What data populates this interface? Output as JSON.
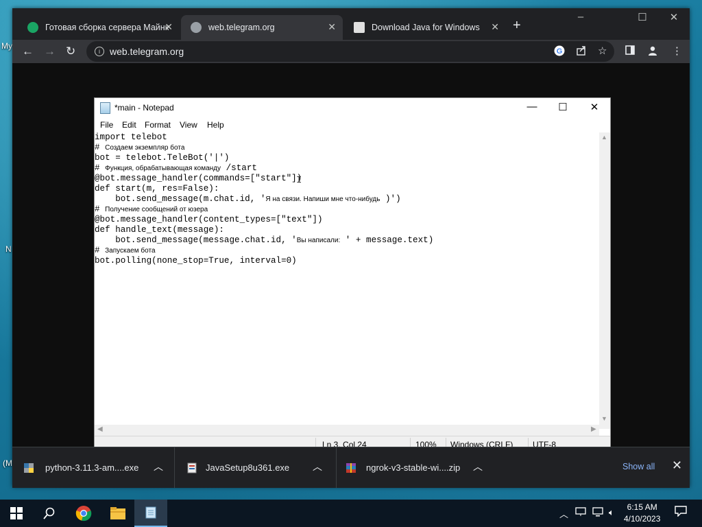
{
  "desktop": {
    "labels": [
      "My",
      "N",
      "(M"
    ]
  },
  "browser": {
    "tabs": [
      {
        "label": "Готовая сборка сервера Майнкрафт",
        "favicon_color": "#1aa564",
        "active": false
      },
      {
        "label": "web.telegram.org",
        "favicon_color": "#9aa0a6",
        "active": true
      },
      {
        "label": "Download Java for Windows",
        "favicon_color": "#e0e0e0",
        "active": false
      }
    ],
    "new_tab_symbol": "+",
    "window_controls": {
      "minimize": "‒",
      "maximize": "☐",
      "close": "✕"
    },
    "toolbar": {
      "back": "←",
      "forward": "→",
      "reload": "↻",
      "url": "web.telegram.org",
      "icons": [
        "google-icon",
        "share-icon",
        "bookmark-star-icon",
        "sidepanel-icon",
        "profile-icon",
        "menu-icon"
      ]
    }
  },
  "notepad": {
    "title": "*main - Notepad",
    "controls": {
      "minimize": "—",
      "maximize": "☐",
      "close": "✕"
    },
    "menu": [
      "File",
      "Edit",
      "Format",
      "View",
      "Help"
    ],
    "code": [
      {
        "code": "import telebot",
        "comment": ""
      },
      {
        "code": "# ",
        "comment": "Создаем экземпляр бота"
      },
      {
        "code": "bot = telebot.TeleBot('|')",
        "comment": ""
      },
      {
        "code": "# ",
        "comment": "Функция, обрабатывающая команду",
        "tail": " /start"
      },
      {
        "code": "@bot.message_handler(commands=[\"start\"])",
        "comment": ""
      },
      {
        "code": "def start(m, res=False):",
        "comment": ""
      },
      {
        "code": "    bot.send_message(m.chat.id, '",
        "comment": "Я на связи. Напиши мне что-нибудь",
        "tail": " )')"
      },
      {
        "code": "# ",
        "comment": "Получение сообщений от юзера"
      },
      {
        "code": "@bot.message_handler(content_types=[\"text\"])",
        "comment": ""
      },
      {
        "code": "def handle_text(message):",
        "comment": ""
      },
      {
        "code": "    bot.send_message(message.chat.id, '",
        "comment": "Вы написали:",
        "tail": " ' + message.text)"
      },
      {
        "code": "# ",
        "comment": "Запускаем бота"
      },
      {
        "code": "bot.polling(none_stop=True, interval=0)",
        "comment": ""
      }
    ],
    "status": {
      "position": "Ln 3, Col 24",
      "zoom": "100%",
      "line_ending": "Windows (CRLF)",
      "encoding": "UTF-8"
    }
  },
  "downloads": {
    "items": [
      {
        "name": "python-3.11.3-am....exe",
        "icon": "python-installer-icon"
      },
      {
        "name": "JavaSetup8u361.exe",
        "icon": "java-installer-icon"
      },
      {
        "name": "ngrok-v3-stable-wi....zip",
        "icon": "zip-archive-icon"
      }
    ],
    "show_all": "Show all",
    "close": "✕"
  },
  "taskbar": {
    "apps": [
      "windows-start-icon",
      "search-icon",
      "chrome-icon",
      "file-explorer-icon",
      "notepad-icon"
    ],
    "tray": [
      "chevron-up-icon",
      "network-icon",
      "monitor-icon",
      "volume-icon"
    ],
    "time": "6:15 AM",
    "date": "4/10/2023",
    "notification_icon": "notification-icon"
  },
  "colors": {
    "chrome_dark": "#202124",
    "chrome_toolbar": "#35363a",
    "link_blue": "#8ab4f8",
    "taskbar": "#0b1622"
  }
}
